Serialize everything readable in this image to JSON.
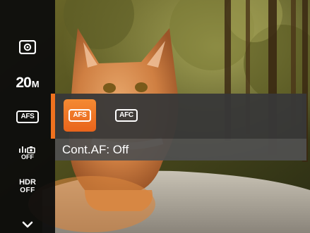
{
  "sidebar": {
    "items": [
      {
        "name": "metering-mode",
        "icon": "metering-icon"
      },
      {
        "name": "image-size",
        "value": "20",
        "unit": "M"
      },
      {
        "name": "focus-mode",
        "label": "AFS"
      },
      {
        "name": "continuous-shot",
        "icon": "continuous-shot-icon",
        "sub": "OFF"
      },
      {
        "name": "hdr",
        "label": "HDR",
        "sub": "OFF"
      },
      {
        "name": "more",
        "icon": "chevron-down-icon"
      }
    ]
  },
  "submenu": {
    "options": [
      {
        "label": "AFS",
        "selected": true
      },
      {
        "label": "AFC",
        "selected": false
      }
    ],
    "status": "Cont.AF: Off"
  },
  "colors": {
    "accent": "#f0721e",
    "sidebar_bg": "#0c0c0c",
    "submenu_bg": "#383838",
    "status_bg": "#505050"
  }
}
